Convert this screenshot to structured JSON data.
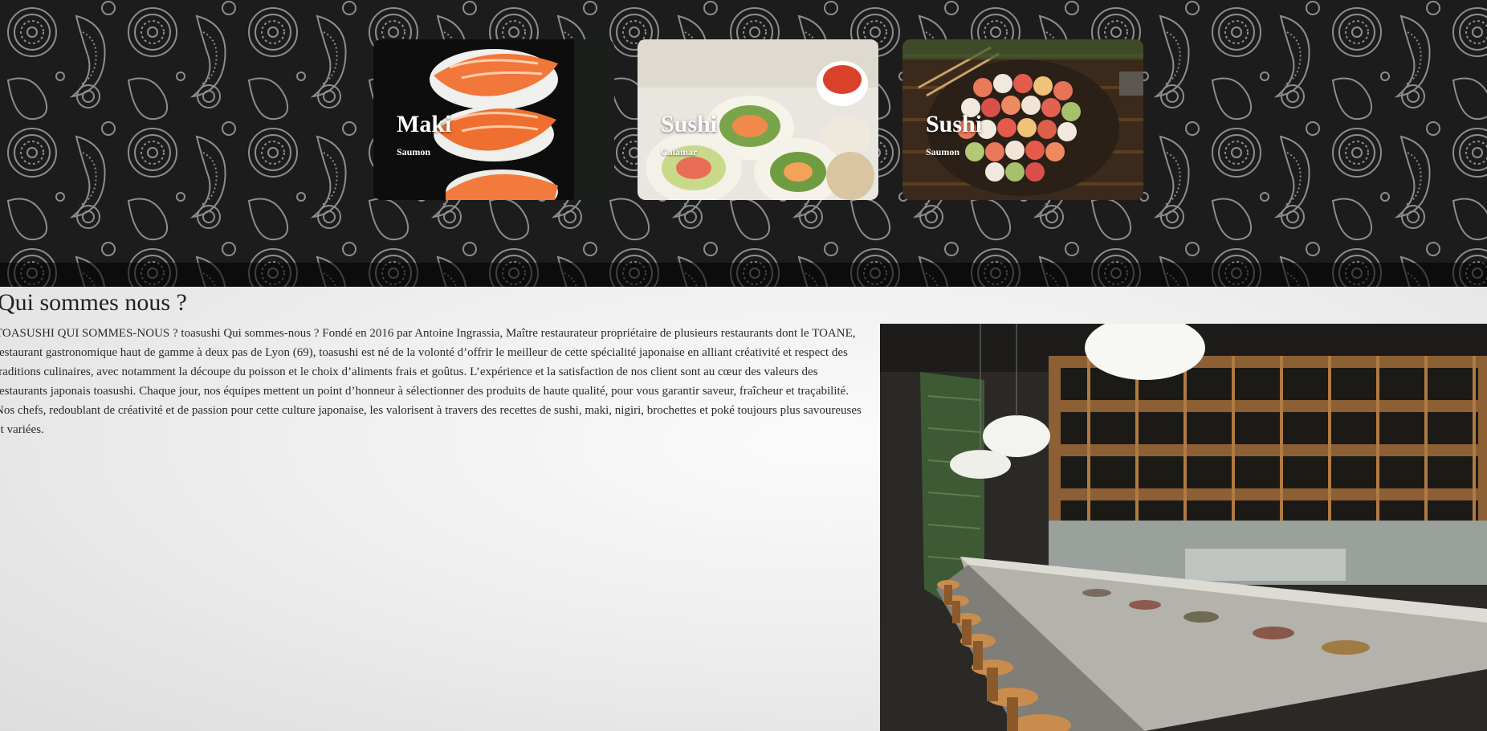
{
  "hero": {
    "cards": [
      {
        "title": "Maki",
        "subtitle": "Saumon"
      },
      {
        "title": "Sushi",
        "subtitle": "Calamar"
      },
      {
        "title": "Sushi",
        "subtitle": "Saumon"
      }
    ]
  },
  "about": {
    "heading": "Qui sommes nous ?",
    "text": "TOASUSHI QUI SOMMES-NOUS ? toasushi Qui sommes-nous ? Fondé en 2016 par Antoine Ingrassia, Maître restaurateur propriétaire de plusieurs restaurants dont le TOANE, restaurant gastronomique haut de gamme à deux pas de Lyon (69), toasushi est né de la volonté d’offrir le meilleur de cette spécialité japonaise en alliant créativité et respect des traditions culinaires, avec notamment la découpe du poisson et le choix d’aliments frais et goûtus. L’expérience et la satisfaction de nos client sont au cœur des valeurs des restaurants japonais toasushi. Chaque jour, nos équipes mettent un point d’honneur à sélectionner des produits de haute qualité, pour vous garantir saveur, fraîcheur et traçabilité. Nos chefs, redoublant de créativité et de passion pour cette culture japonaise, les valorisent à travers des recettes de sushi, maki, nigiri, brochettes et poké toujours plus savoureuses et variées."
  },
  "colors": {
    "hero_bg": "#1c1c1c",
    "paisley_line": "#8a8a8a",
    "salmon": "#f2773a",
    "wood": "#b07a43"
  }
}
